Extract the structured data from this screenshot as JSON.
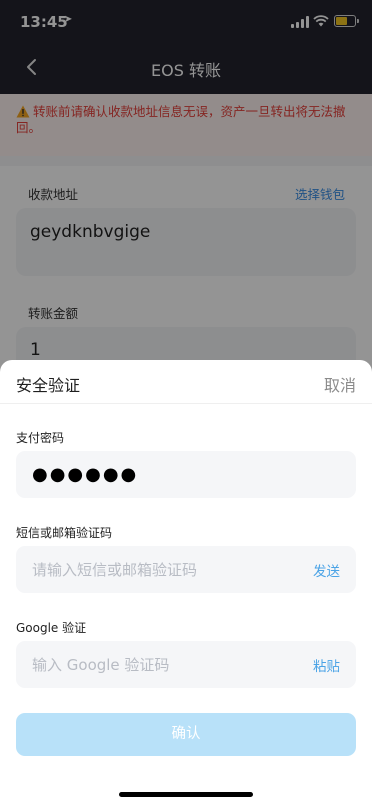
{
  "status_bar": {
    "time": "13:45"
  },
  "nav": {
    "title": "EOS 转账"
  },
  "form": {
    "warning": "转账前请确认收款地址信息无误，资产一旦转出将无法撤回。",
    "recipient_label": "收款地址",
    "choose_wallet": "选择钱包",
    "recipient_value": "geydknbvgige",
    "amount_label": "转账金额",
    "amount_value": "1"
  },
  "sheet": {
    "title": "安全验证",
    "cancel": "取消",
    "password_label": "支付密码",
    "password_value": "●●●●●●",
    "code_label": "短信或邮箱验证码",
    "code_placeholder": "请输入短信或邮箱验证码",
    "code_action": "发送",
    "google_label": "Google 验证",
    "google_placeholder": "输入 Google 验证码",
    "google_action": "粘贴",
    "confirm": "确认"
  },
  "colors": {
    "header_bg": "#23232d",
    "warning_text": "#e5413b",
    "link": "#3a8ee6",
    "confirm_disabled": "#b8e1f9",
    "battery": "#f3c623"
  }
}
